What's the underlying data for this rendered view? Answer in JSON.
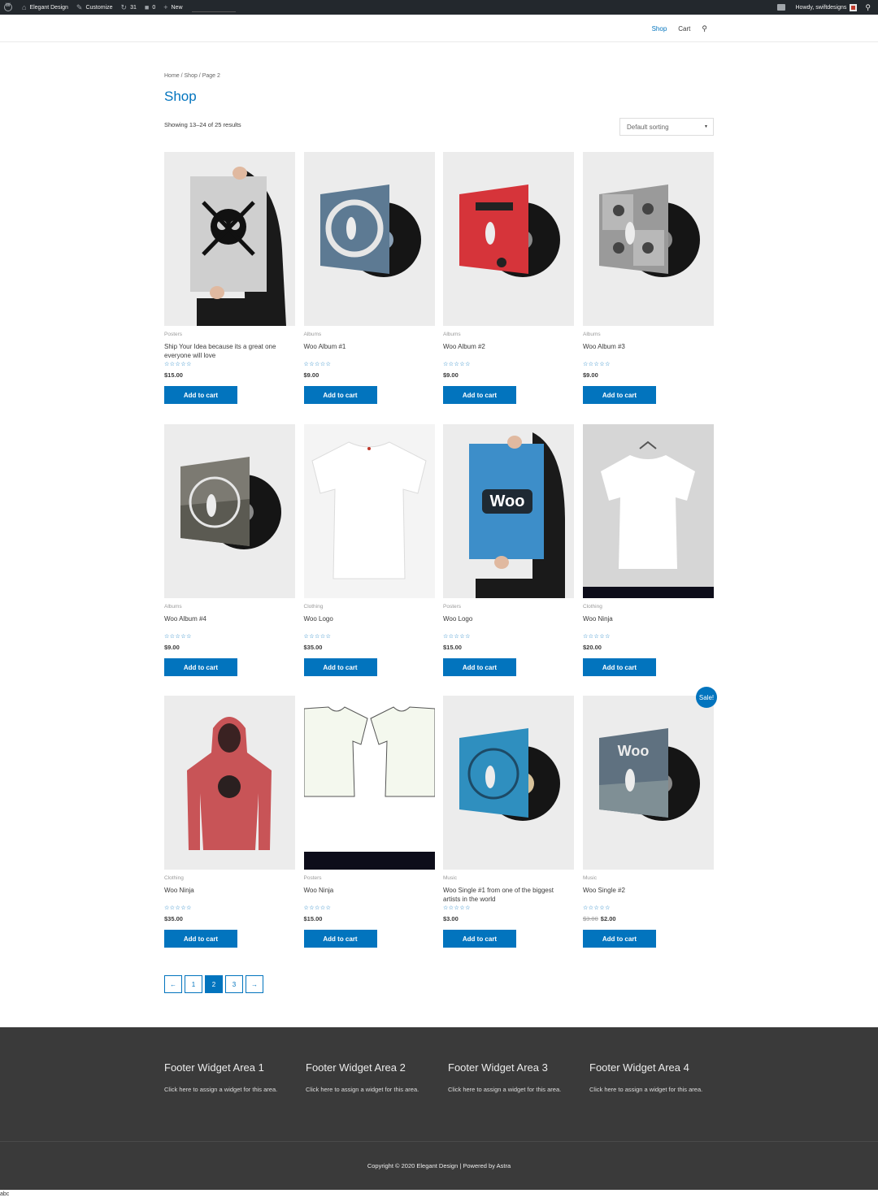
{
  "admin_bar": {
    "site_name": "Elegant Design",
    "customize": "Customize",
    "updates_count": "31",
    "comments_count": "0",
    "new_label": "New",
    "howdy": "Howdy, swiftdesigns"
  },
  "nav": {
    "items": [
      {
        "label": "Shop"
      },
      {
        "label": "Cart"
      }
    ]
  },
  "breadcrumb": "Home / Shop / Page 2",
  "page_title": "Shop",
  "result_count": "Showing 13–24 of 25 results",
  "sorting": {
    "selected": "Default sorting"
  },
  "products": [
    {
      "category": "Posters",
      "name": "Ship Your Idea because its a great one everyone will love",
      "price": "$15.00",
      "button": "Add to cart",
      "art": "poster-skull"
    },
    {
      "category": "Albums",
      "name": "Woo Album #1",
      "price": "$9.00",
      "button": "Add to cart",
      "art": "album-1"
    },
    {
      "category": "Albums",
      "name": "Woo Album #2",
      "price": "$9.00",
      "button": "Add to cart",
      "art": "album-2"
    },
    {
      "category": "Albums",
      "name": "Woo Album #3",
      "price": "$9.00",
      "button": "Add to cart",
      "art": "album-3"
    },
    {
      "category": "Albums",
      "name": "Woo Album #4",
      "price": "$9.00",
      "button": "Add to cart",
      "art": "album-4"
    },
    {
      "category": "Clothing",
      "name": "Woo Logo",
      "price": "$35.00",
      "button": "Add to cart",
      "art": "tshirt"
    },
    {
      "category": "Posters",
      "name": "Woo Logo",
      "price": "$15.00",
      "button": "Add to cart",
      "art": "poster-woo"
    },
    {
      "category": "Clothing",
      "name": "Woo Ninja",
      "price": "$20.00",
      "button": "Add to cart",
      "art": "tshirt-hanger"
    },
    {
      "category": "Clothing",
      "name": "Woo Ninja",
      "price": "$35.00",
      "button": "Add to cart",
      "art": "hoodie"
    },
    {
      "category": "Posters",
      "name": "Woo Ninja",
      "price": "$15.00",
      "button": "Add to cart",
      "art": "tshirt-flat"
    },
    {
      "category": "Music",
      "name": "Woo Single #1 from one of the biggest artists in the world",
      "price": "$3.00",
      "button": "Add to cart",
      "art": "single-1"
    },
    {
      "category": "Music",
      "name": "Woo Single #2",
      "old_price": "$3.00",
      "price": "$2.00",
      "button": "Add to cart",
      "sale": "Sale!",
      "art": "single-2"
    }
  ],
  "pagination": [
    "←",
    "1",
    "2",
    "3",
    "→"
  ],
  "footer": {
    "widgets": [
      {
        "title": "Footer Widget Area 1",
        "text": "Click here to assign a widget for this area."
      },
      {
        "title": "Footer Widget Area 2",
        "text": "Click here to assign a widget for this area."
      },
      {
        "title": "Footer Widget Area 3",
        "text": "Click here to assign a widget for this area."
      },
      {
        "title": "Footer Widget Area 4",
        "text": "Click here to assign a widget for this area."
      }
    ],
    "copyright": "Copyright © 2020 Elegant Design | Powered by Astra"
  },
  "status_text": "abc",
  "colors": {
    "accent": "#0274be",
    "footer_bg": "#3a3a3a",
    "adminbar_bg": "#23282d"
  }
}
